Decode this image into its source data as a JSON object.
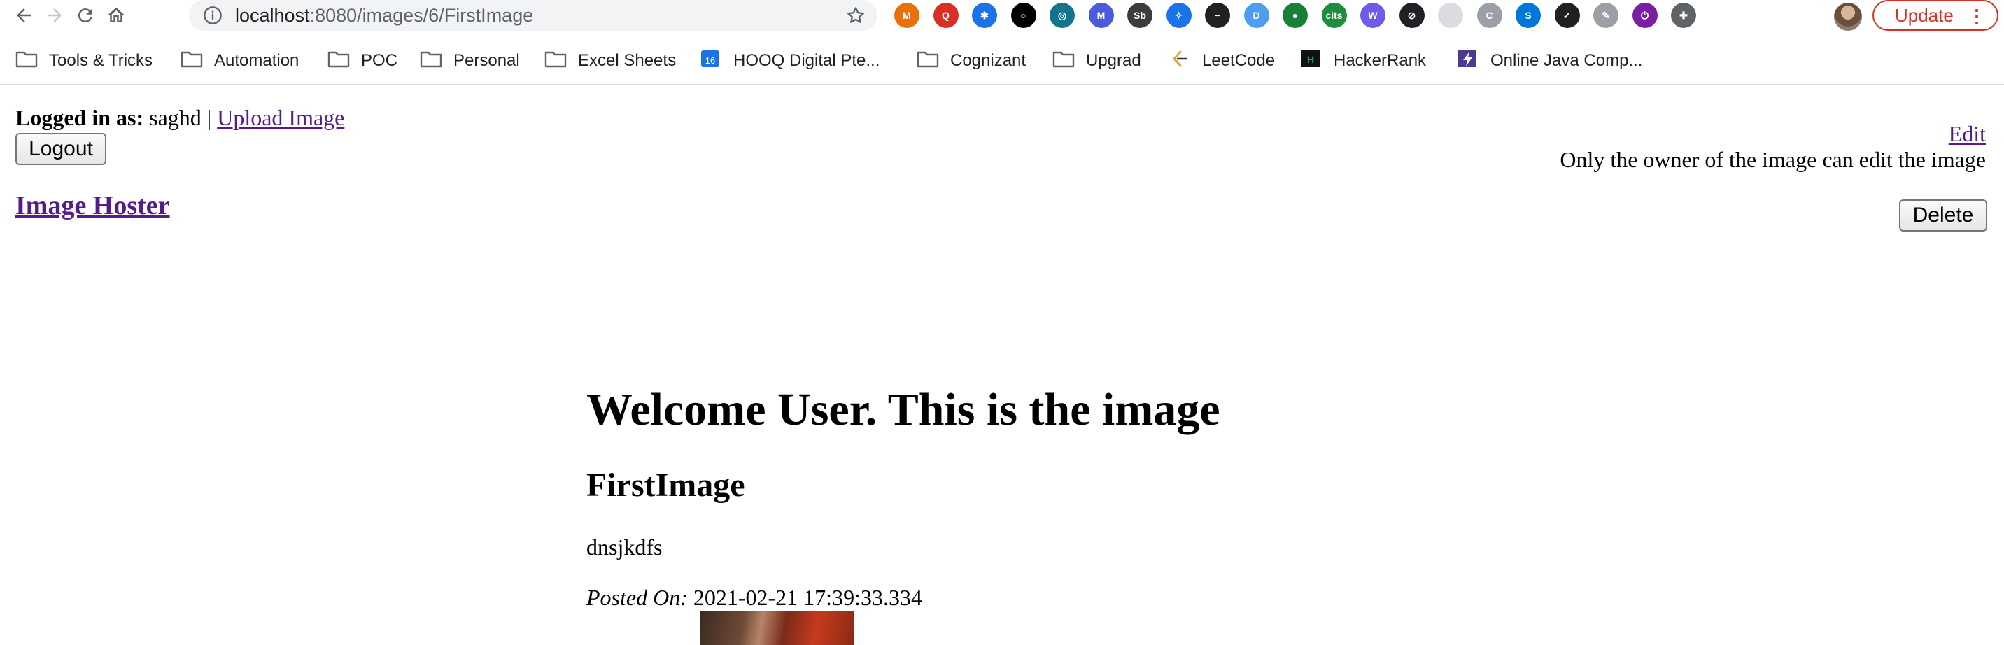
{
  "browser": {
    "url_host": "localhost",
    "url_rest": ":8080/images/6/FirstImage",
    "update_label": "Update",
    "extensions": [
      {
        "name": "m-icon",
        "color": "#e8710a",
        "glyph": "M"
      },
      {
        "name": "quickbooks-icon",
        "color": "#d93025",
        "glyph": "Q"
      },
      {
        "name": "bug-icon",
        "color": "#1a73e8",
        "glyph": "✱"
      },
      {
        "name": "circle-icon",
        "color": "#000000",
        "glyph": "○"
      },
      {
        "name": "aperture-icon",
        "color": "#12758c",
        "glyph": "◎"
      },
      {
        "name": "m-badge-icon",
        "color": "#4a5bdc",
        "glyph": "M"
      },
      {
        "name": "sb-icon",
        "color": "#3c3c3c",
        "glyph": "Sb"
      },
      {
        "name": "compass-icon",
        "color": "#1a73e8",
        "glyph": "✧"
      },
      {
        "name": "minus-circle-icon",
        "color": "#202124",
        "glyph": "−"
      },
      {
        "name": "d-icon",
        "color": "#4e9df0",
        "glyph": "D"
      },
      {
        "name": "chat-bubble-icon",
        "color": "#188038",
        "glyph": "●"
      },
      {
        "name": "cits-icon",
        "color": "#1e8e3e",
        "glyph": "cits"
      },
      {
        "name": "web-icon",
        "color": "#6c5ce7",
        "glyph": "W"
      },
      {
        "name": "eye-slash-icon",
        "color": "#202124",
        "glyph": "⊘"
      },
      {
        "name": "grey-square-icon",
        "color": "#dadce0",
        "glyph": ""
      },
      {
        "name": "c-icon",
        "color": "#9aa0a6",
        "glyph": "C"
      },
      {
        "name": "skype-icon",
        "color": "#0078d7",
        "glyph": "S"
      },
      {
        "name": "checkbox-icon",
        "color": "#202124",
        "glyph": "✓"
      },
      {
        "name": "edge-icon",
        "color": "#9aa0a6",
        "glyph": "✎"
      },
      {
        "name": "power-icon",
        "color": "#7b1fa2",
        "glyph": "⏻"
      },
      {
        "name": "puzzle-icon",
        "color": "#5f6368",
        "glyph": "✚"
      }
    ]
  },
  "bookmarks": [
    {
      "label": "Tools & Tricks",
      "icon": "folder-icon"
    },
    {
      "label": "Automation",
      "icon": "folder-icon"
    },
    {
      "label": "POC",
      "icon": "folder-icon"
    },
    {
      "label": "Personal",
      "icon": "folder-icon"
    },
    {
      "label": "Excel Sheets",
      "icon": "folder-icon"
    },
    {
      "label": "HOOQ Digital Pte...",
      "icon": "calendar-icon"
    },
    {
      "label": "Cognizant",
      "icon": "folder-icon"
    },
    {
      "label": "Upgrad",
      "icon": "folder-icon"
    },
    {
      "label": "LeetCode",
      "icon": "leetcode-icon"
    },
    {
      "label": "HackerRank",
      "icon": "hackerrank-icon"
    },
    {
      "label": "Online Java Comp...",
      "icon": "lightning-icon"
    }
  ],
  "header": {
    "logged_in_label": "Logged in as:",
    "username": "saghd",
    "separator": "|",
    "upload_link": "Upload Image",
    "logout_label": "Logout",
    "brand": "Image Hoster"
  },
  "owner_actions": {
    "edit_link": "Edit",
    "edit_note": "Only the owner of the image can edit the image",
    "delete_label": "Delete"
  },
  "main": {
    "heading": "Welcome User. This is the image",
    "image_title": "FirstImage",
    "description": "dnsjkdfs",
    "posted_label": "Posted On:",
    "posted_value": "2021-02-21 17:39:33.334"
  },
  "calendar_badge": "16"
}
